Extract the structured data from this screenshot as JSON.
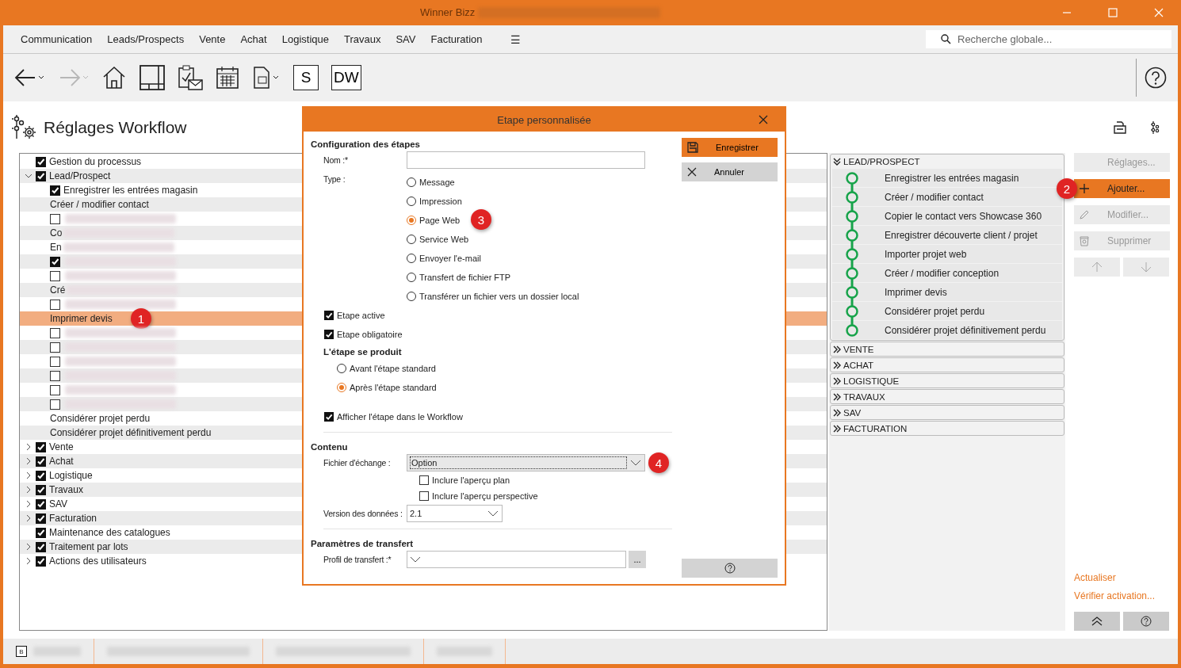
{
  "window": {
    "title": "Winner Bizz"
  },
  "menu": [
    {
      "label": "Communication"
    },
    {
      "label": "Leads/Prospects"
    },
    {
      "label": "Vente"
    },
    {
      "label": "Achat"
    },
    {
      "label": "Logistique"
    },
    {
      "label": "Travaux"
    },
    {
      "label": "SAV"
    },
    {
      "label": "Facturation"
    },
    {
      "label": "☰"
    }
  ],
  "search": {
    "placeholder": "Recherche globale..."
  },
  "toolbar": [
    {
      "kind": "back",
      "disabled": false
    },
    {
      "kind": "forward",
      "disabled": true
    },
    {
      "kind": "home"
    },
    {
      "kind": "layout"
    },
    {
      "kind": "tasks"
    },
    {
      "kind": "calendar"
    },
    {
      "kind": "document"
    },
    {
      "kind": "text",
      "label": "S"
    },
    {
      "kind": "text",
      "label": "DW"
    }
  ],
  "page": {
    "title": "Réglages Workflow"
  },
  "tree": [
    {
      "kind": "check",
      "label": "Gestion du processus",
      "checked": true,
      "selected": false
    },
    {
      "kind": "check",
      "label": "Lead/Prospect",
      "checked": true,
      "selected": false,
      "expanded": true,
      "children": [
        {
          "kind": "check",
          "label": "Enregistrer les entrées magasin",
          "checked": true,
          "selected": false
        },
        {
          "kind": "step",
          "label": "Créer / modifier contact",
          "selected": false
        },
        {
          "kind": "check",
          "checked": false,
          "redacted": true,
          "selected": false
        },
        {
          "kind": "step",
          "label": "Co",
          "redacted": true,
          "selected": false
        },
        {
          "kind": "step",
          "label": "En",
          "redacted": true,
          "selected": false
        },
        {
          "kind": "check",
          "checked": true,
          "redacted": true,
          "selected": false
        },
        {
          "kind": "check",
          "checked": false,
          "redacted": true,
          "selected": false
        },
        {
          "kind": "step",
          "label": "Cré",
          "redacted": true,
          "selected": false
        },
        {
          "kind": "check",
          "checked": false,
          "redacted": true,
          "selected": false
        },
        {
          "kind": "step",
          "label": "Imprimer devis",
          "selected": true,
          "callout": "1"
        },
        {
          "kind": "check",
          "checked": false,
          "redacted": true,
          "selected": false
        },
        {
          "kind": "check",
          "checked": false,
          "redacted": true,
          "selected": false
        },
        {
          "kind": "check",
          "checked": false,
          "redacted": true,
          "selected": false
        },
        {
          "kind": "check",
          "checked": false,
          "redacted": true,
          "selected": false
        },
        {
          "kind": "check",
          "checked": false,
          "redacted": true,
          "selected": false
        },
        {
          "kind": "check",
          "checked": false,
          "redacted": true,
          "selected": false
        },
        {
          "kind": "step",
          "label": "Considérer projet perdu",
          "selected": false
        },
        {
          "kind": "step",
          "label": "Considérer projet définitivement perdu",
          "selected": false
        }
      ]
    },
    {
      "kind": "check",
      "label": "Vente",
      "checked": true,
      "selected": false,
      "expanded": false
    },
    {
      "kind": "check",
      "label": "Achat",
      "checked": true,
      "selected": false,
      "expanded": false
    },
    {
      "kind": "check",
      "label": "Logistique",
      "checked": true,
      "selected": false,
      "expanded": false
    },
    {
      "kind": "check",
      "label": "Travaux",
      "checked": true,
      "selected": false,
      "expanded": false
    },
    {
      "kind": "check",
      "label": "SAV",
      "checked": true,
      "selected": false,
      "expanded": false
    },
    {
      "kind": "check",
      "label": "Facturation",
      "checked": true,
      "selected": false,
      "expanded": false
    },
    {
      "kind": "check",
      "label": "Maintenance des catalogues",
      "checked": true,
      "selected": false
    },
    {
      "kind": "check",
      "label": "Traitement par lots",
      "checked": true,
      "selected": false,
      "expanded": false
    },
    {
      "kind": "check",
      "label": "Actions des utilisateurs",
      "checked": true,
      "selected": false,
      "expanded": false
    }
  ],
  "workflow": [
    {
      "label": "LEAD/PROSPECT",
      "expanded": true,
      "steps": [
        "Enregistrer les entrées magasin",
        "Créer / modifier contact",
        "Copier le contact vers Showcase 360",
        "Enregistrer découverte client / projet",
        "Importer projet web",
        "Créer / modifier conception",
        "Imprimer devis",
        "Considérer projet perdu",
        "Considérer projet définitivement perdu"
      ]
    },
    {
      "label": "VENTE",
      "expanded": false
    },
    {
      "label": "ACHAT",
      "expanded": false
    },
    {
      "label": "LOGISTIQUE",
      "expanded": false
    },
    {
      "label": "TRAVAUX",
      "expanded": false
    },
    {
      "label": "SAV",
      "expanded": false
    },
    {
      "label": "FACTURATION",
      "expanded": false
    }
  ],
  "actions": [
    {
      "kind": "settings",
      "label": "Réglages...",
      "disabled": true
    },
    {
      "kind": "add",
      "label": "Ajouter...",
      "disabled": false,
      "callout": "2"
    },
    {
      "kind": "edit",
      "label": "Modifier...",
      "disabled": true
    },
    {
      "kind": "delete",
      "label": "Supprimer",
      "disabled": true
    }
  ],
  "move_buttons": [
    {
      "kind": "up",
      "disabled": true
    },
    {
      "kind": "down",
      "disabled": true
    }
  ],
  "links": [
    "Actualiser",
    "Vérifier activation..."
  ],
  "dialog": {
    "title": "Etape personnalisée",
    "save_label": "Enregistrer",
    "cancel_label": "Annuler",
    "config": {
      "heading": "Configuration des étapes",
      "name_label": "Nom :*",
      "type_label": "Type :",
      "types": [
        {
          "label": "Message",
          "selected": false
        },
        {
          "label": "Impression",
          "selected": false
        },
        {
          "label": "Page Web",
          "selected": true,
          "callout": "3"
        },
        {
          "label": "Service Web",
          "selected": false
        },
        {
          "label": "Envoyer l'e-mail",
          "selected": false
        },
        {
          "label": "Transfert de fichier FTP",
          "selected": false
        },
        {
          "label": "Transférer un fichier vers un dossier local",
          "selected": false
        }
      ],
      "checks": [
        {
          "label": "Etape active",
          "checked": true
        },
        {
          "label": "Etape obligatoire",
          "checked": true
        }
      ],
      "timing_heading": "L'étape se produit",
      "timing": [
        {
          "label": "Avant l'étape standard",
          "selected": false
        },
        {
          "label": "Après l'étape standard",
          "selected": true
        }
      ],
      "show_in_workflow": {
        "label": "Afficher l'étape dans le Workflow",
        "checked": true
      }
    },
    "content": {
      "heading": "Contenu",
      "exchange_label": "Fichier d'échange :",
      "exchange_value": "Option",
      "callout": "4",
      "options": [
        {
          "label": "Inclure l'aperçu plan",
          "checked": false
        },
        {
          "label": "Inclure l'aperçu perspective",
          "checked": false
        }
      ],
      "version_label": "Version des données :",
      "version_value": "2.1"
    },
    "transfer": {
      "heading": "Paramètres de transfert",
      "profile_label": "Profil de transfert :*",
      "browse_label": "..."
    }
  },
  "status_bar": {
    "badge": "B"
  }
}
